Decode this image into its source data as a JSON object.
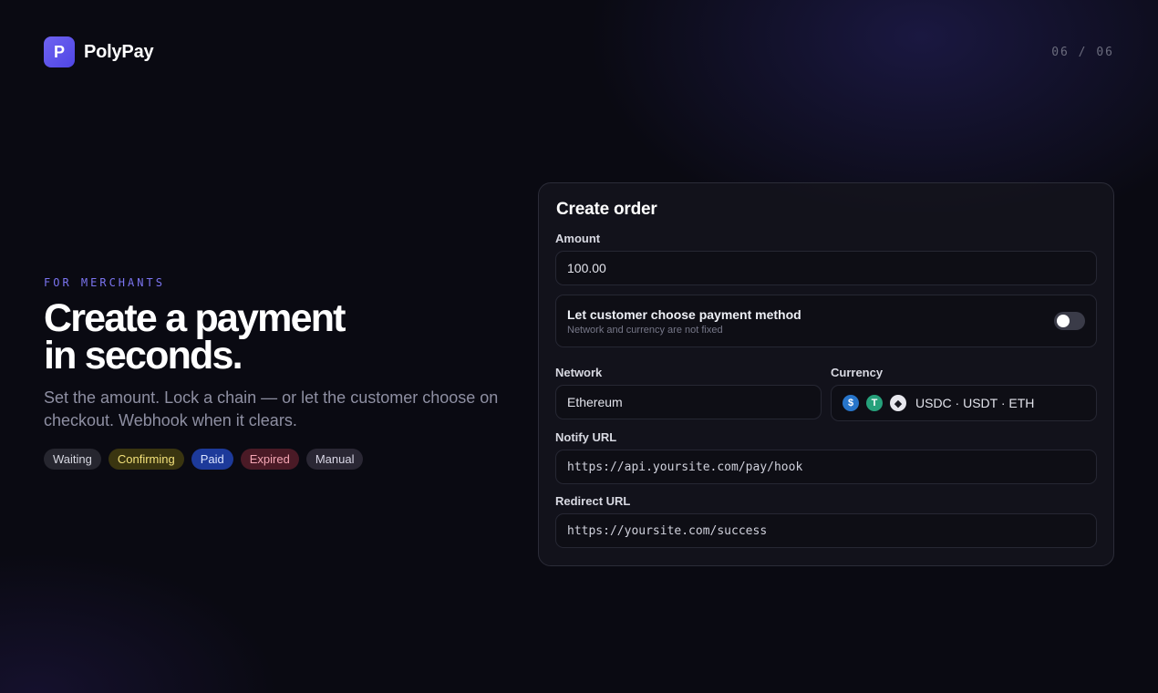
{
  "brand": {
    "logo_letter": "P",
    "name": "PolyPay"
  },
  "page_counter": "06 / 06",
  "hero": {
    "eyebrow": "FOR MERCHANTS",
    "headline": "Create a payment in seconds.",
    "subtext": "Set the amount. Lock a chain — or let the customer choose on checkout. Webhook when it clears.",
    "badges": [
      {
        "label": "Waiting",
        "color": "#26262f"
      },
      {
        "label": "Confirming",
        "color": "#3a3510"
      },
      {
        "label": "Paid",
        "color": "#1d3a9a"
      },
      {
        "label": "Expired",
        "color": "#4a1a26"
      },
      {
        "label": "Manual",
        "color": "#2a2734"
      }
    ]
  },
  "order_form": {
    "title": "Create order",
    "amount": {
      "label": "Amount",
      "value": "100.00"
    },
    "choose_method": {
      "title": "Let customer choose payment method",
      "subtitle": "Network and currency are not fixed",
      "enabled": false
    },
    "network": {
      "label": "Network",
      "value": "Ethereum"
    },
    "currency": {
      "label": "Currency",
      "value": "USDC · USDT · ETH",
      "icons": [
        "usdc-icon",
        "usdt-icon",
        "eth-icon"
      ]
    },
    "notify_url": {
      "label": "Notify URL",
      "value": "https://api.yoursite.com/pay/hook"
    },
    "redirect_url": {
      "label": "Redirect URL",
      "value": "https://yoursite.com/success"
    }
  },
  "colors": {
    "accent": "#5b50ec",
    "background": "#0a0a12",
    "card": "#14141c"
  }
}
